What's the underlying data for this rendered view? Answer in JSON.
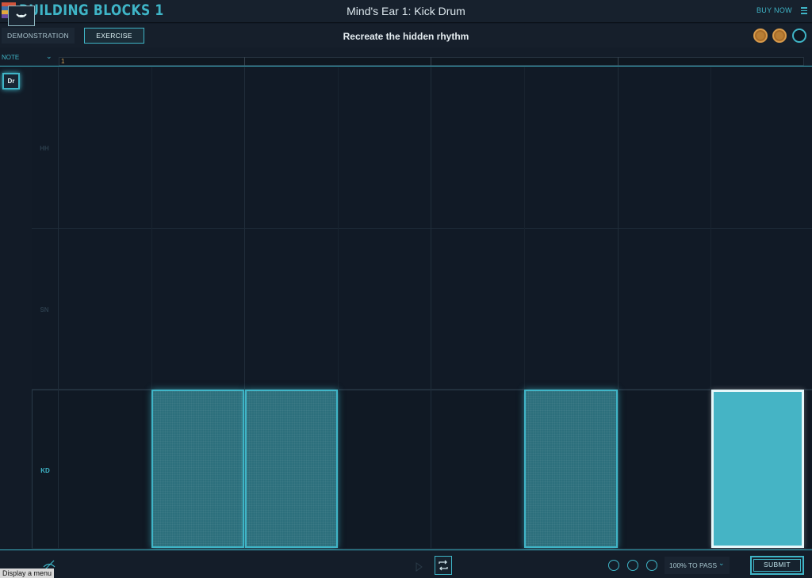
{
  "app": {
    "name": "BUILDING BLOCKS 1",
    "title": "Mind's Ear 1: Kick Drum",
    "buy_now": "BUY NOW"
  },
  "modes": {
    "demonstration": "DEMONSTRATION",
    "exercise": "EXERCISE",
    "active": "exercise"
  },
  "instruction": "Recreate the hidden rhythm",
  "lives": {
    "filled": 2,
    "total": 3
  },
  "note_selector": {
    "label": "NOTE"
  },
  "ruler": {
    "bar_number": "1"
  },
  "instrument_button": "Dr",
  "lanes": [
    {
      "label": "HH"
    },
    {
      "label": "SN"
    },
    {
      "label": "KD"
    }
  ],
  "kick_pattern": {
    "steps": 8,
    "active": [
      1,
      2,
      5,
      7
    ],
    "selected": 7
  },
  "bottom": {
    "tooltip": "Display a menu",
    "pass_threshold": "100% TO PASS",
    "submit": "SUBMIT",
    "attempt_circles": 3
  },
  "colors": {
    "accent": "#3fb5c7",
    "coin": "#b97e34",
    "background": "#111a26"
  }
}
